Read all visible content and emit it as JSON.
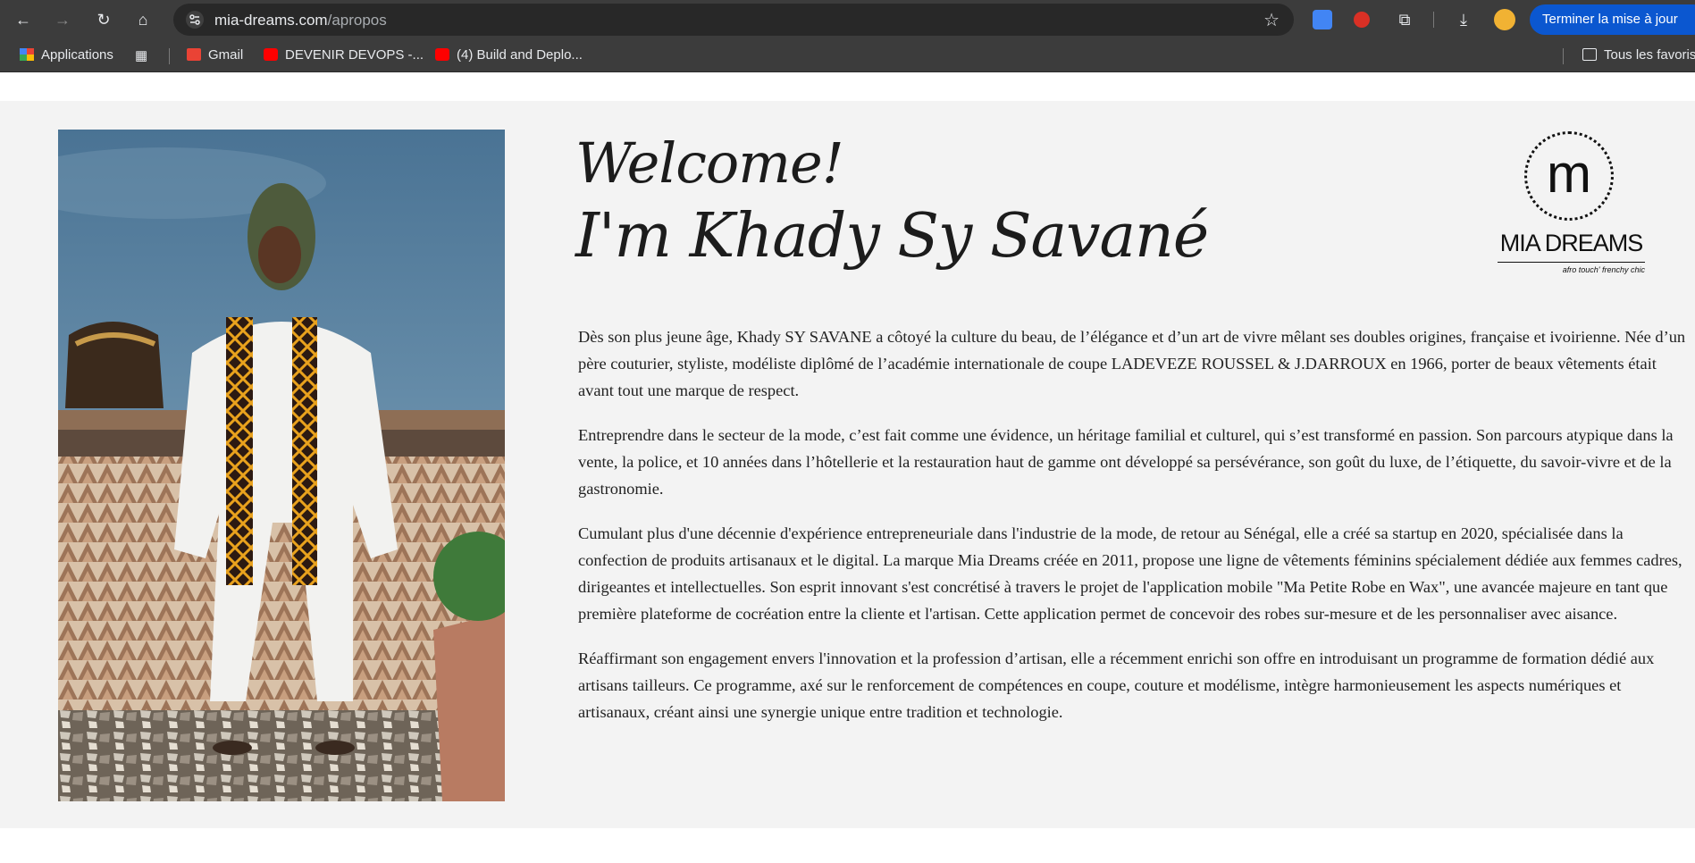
{
  "browser": {
    "url_host": "mia-dreams.com",
    "url_path": "/apropos",
    "finish_update_label": "Terminer la mise à jour",
    "icons": [
      "back-icon",
      "forward-icon",
      "reload-icon",
      "home-icon",
      "site-info-icon",
      "bookmark-star-icon",
      "google-translate-icon",
      "extension-s-icon",
      "extensions-puzzle-icon",
      "download-icon",
      "profile-avatar",
      "more-menu-icon"
    ]
  },
  "bookmarks": {
    "apps_label": "Applications",
    "items": [
      "Gmail",
      "DEVENIR DEVOPS -...",
      "(4) Build and Deplo..."
    ],
    "all_bookmarks_label": "Tous les favoris"
  },
  "page": {
    "heading_line1": "Welcome!",
    "heading_line2": "I'm Khady Sy Savané",
    "logo": {
      "name": "MIA DREAMS",
      "tagline": "afro touch' frenchy chic",
      "mark": "m"
    },
    "paragraphs": [
      "Dès son plus jeune âge, Khady SY SAVANE a côtoyé la culture du beau, de l’élégance et d’un art de vivre mêlant ses doubles origines, française et ivoirienne. Née d’un père couturier, styliste, modéliste diplômé de l’académie internationale de coupe LADEVEZE ROUSSEL & J.DARROUX en 1966, porter de beaux vêtements était avant tout une marque de respect.",
      "Entreprendre dans le secteur de la mode, c’est fait comme une évidence, un héritage familial et culturel, qui s’est transformé en passion. Son parcours atypique dans la vente, la police, et 10 années dans l’hôtellerie et la restauration haut de gamme ont développé sa persévérance, son goût du luxe, de l’étiquette, du savoir-vivre et de la gastronomie.",
      "Cumulant plus d'une décennie d'expérience entrepreneuriale dans l'industrie de la mode, de retour au Sénégal, elle a créé sa startup en 2020, spécialisée dans la confection de produits artisanaux et le digital. La marque Mia Dreams créée en 2011, propose une ligne de vêtements féminins spécialement dédiée aux femmes cadres, dirigeantes et intellectuelles. Son esprit innovant s'est concrétisé à travers le projet de l'application mobile \"Ma Petite Robe en Wax\", une avancée majeure en tant que première plateforme de cocréation entre la cliente et l'artisan. Cette application permet de concevoir des robes sur-mesure et de les personnaliser avec aisance.",
      "Réaffirmant son engagement envers l'innovation et la profession d’artisan, elle a récemment enrichi son offre en introduisant un programme de formation dédié aux artisans tailleurs. Ce programme, axé sur le renforcement de compétences en coupe, couture et modélisme, intègre harmonieusement les aspects numériques et artisanaux, créant ainsi une synergie unique entre tradition et technologie."
    ]
  }
}
